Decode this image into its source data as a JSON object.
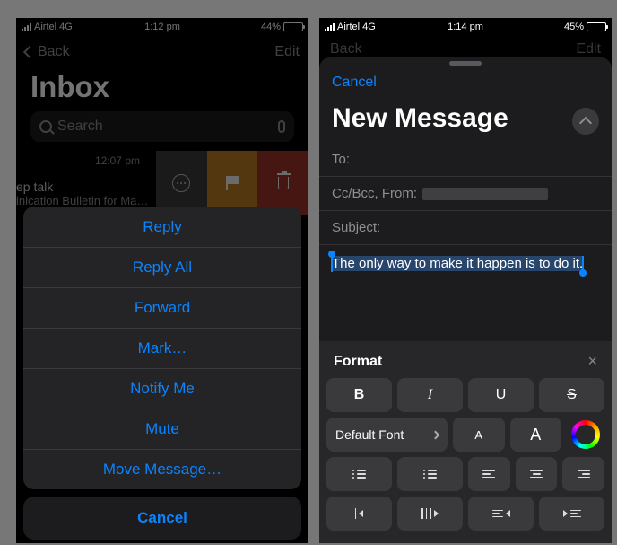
{
  "left": {
    "status": {
      "carrier": "Airtel 4G",
      "time": "1:12 pm",
      "battery_pct": "44%"
    },
    "nav": {
      "back": "Back",
      "edit": "Edit"
    },
    "title": "Inbox",
    "search_placeholder": "Search",
    "mail": {
      "time": "12:07 pm",
      "subject": "ep talk",
      "preview": "inication Bulletin for Ma…"
    },
    "sheet": {
      "items": [
        "Reply",
        "Reply All",
        "Forward",
        "Mark…",
        "Notify Me",
        "Mute",
        "Move Message…"
      ],
      "cancel": "Cancel"
    }
  },
  "right": {
    "status": {
      "carrier": "Airtel 4G",
      "time": "1:14 pm",
      "battery_pct": "45%"
    },
    "nav_blur": {
      "back": "Back",
      "edit": "Edit"
    },
    "modal": {
      "cancel": "Cancel",
      "title": "New Message",
      "fields": {
        "to": "To:",
        "ccbcc": "Cc/Bcc, From:",
        "subject": "Subject:"
      },
      "body_text": "The only way to make it happen is to do it."
    },
    "format": {
      "title": "Format",
      "bold": "B",
      "italic": "I",
      "underline": "U",
      "strike": "S",
      "font": "Default Font",
      "size_small": "A",
      "size_big": "A"
    }
  }
}
